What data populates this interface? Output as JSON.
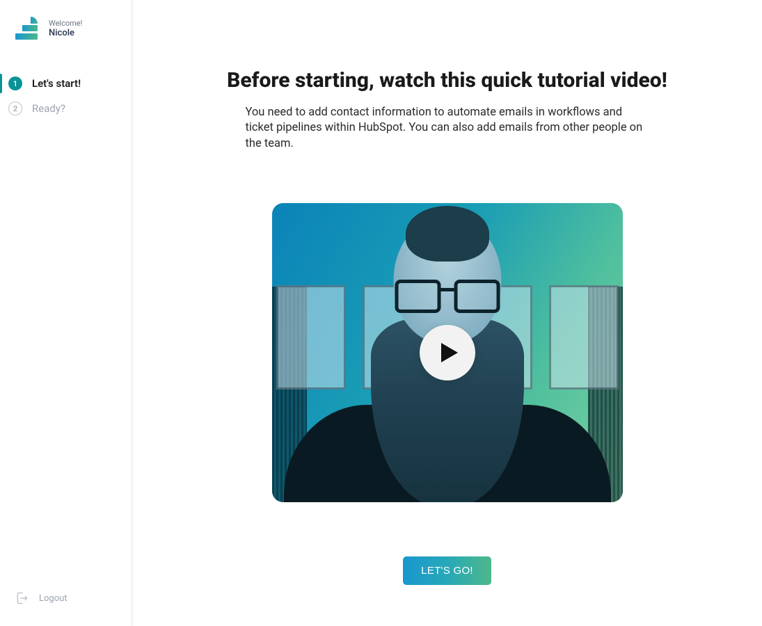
{
  "sidebar": {
    "welcome_label": "Welcome!",
    "user_name": "Nicole",
    "steps": [
      {
        "number": "1",
        "label": "Let's start!",
        "active": true
      },
      {
        "number": "2",
        "label": "Ready?",
        "active": false
      }
    ],
    "logout_label": "Logout"
  },
  "main": {
    "heading": "Before starting, watch this quick tutorial video!",
    "subtitle": "You need to add contact information to automate emails in workflows and ticket pipelines within HubSpot. You can also add emails from other people on the team.",
    "cta_label": "LET'S GO!"
  },
  "colors": {
    "accent_teal": "#0a9396",
    "cta_gradient_start": "#1a97cf",
    "cta_gradient_end": "#4db88a"
  }
}
